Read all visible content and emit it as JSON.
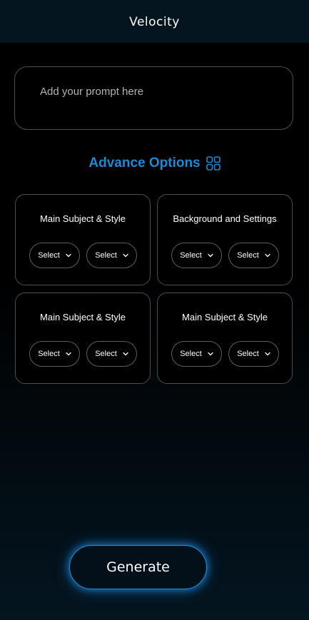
{
  "header": {
    "title": "Velocity"
  },
  "prompt": {
    "placeholder": "Add your prompt here",
    "value": ""
  },
  "advance": {
    "label": "Advance Options",
    "icon": "grid-icon",
    "color": "#1c8ad6"
  },
  "cards": [
    {
      "title": "Main Subject & Style",
      "selects": [
        "Select",
        "Select"
      ]
    },
    {
      "title": "Background and Settings",
      "selects": [
        "Select",
        "Select"
      ]
    },
    {
      "title": "Main Subject & Style",
      "selects": [
        "Select",
        "Select"
      ]
    },
    {
      "title": "Main Subject & Style",
      "selects": [
        "Select",
        "Select"
      ]
    }
  ],
  "generate": {
    "label": "Generate",
    "glow_color": "#1f8fe0"
  }
}
